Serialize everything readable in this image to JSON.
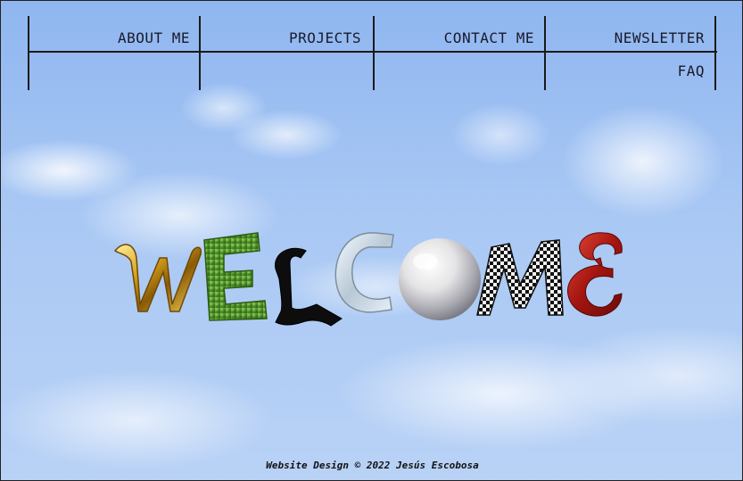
{
  "nav": {
    "items": [
      {
        "label": "ABOUT ME"
      },
      {
        "label": "PROJECTS"
      },
      {
        "label": "CONTACT ME"
      },
      {
        "label": "NEWSLETTER"
      },
      {
        "label": "FAQ"
      }
    ]
  },
  "hero": {
    "letters": [
      "W",
      "E",
      "L",
      "C",
      "O",
      "M",
      "E"
    ],
    "word": "WELCOME"
  },
  "footer": {
    "text": "Website Design © 2022 Jesús Escobosa"
  },
  "colors": {
    "sky": "#9dc0f0",
    "lines": "#1a1a1a",
    "gold": "#d4a017",
    "grass": "#4f8f2a",
    "red": "#b3201c"
  }
}
